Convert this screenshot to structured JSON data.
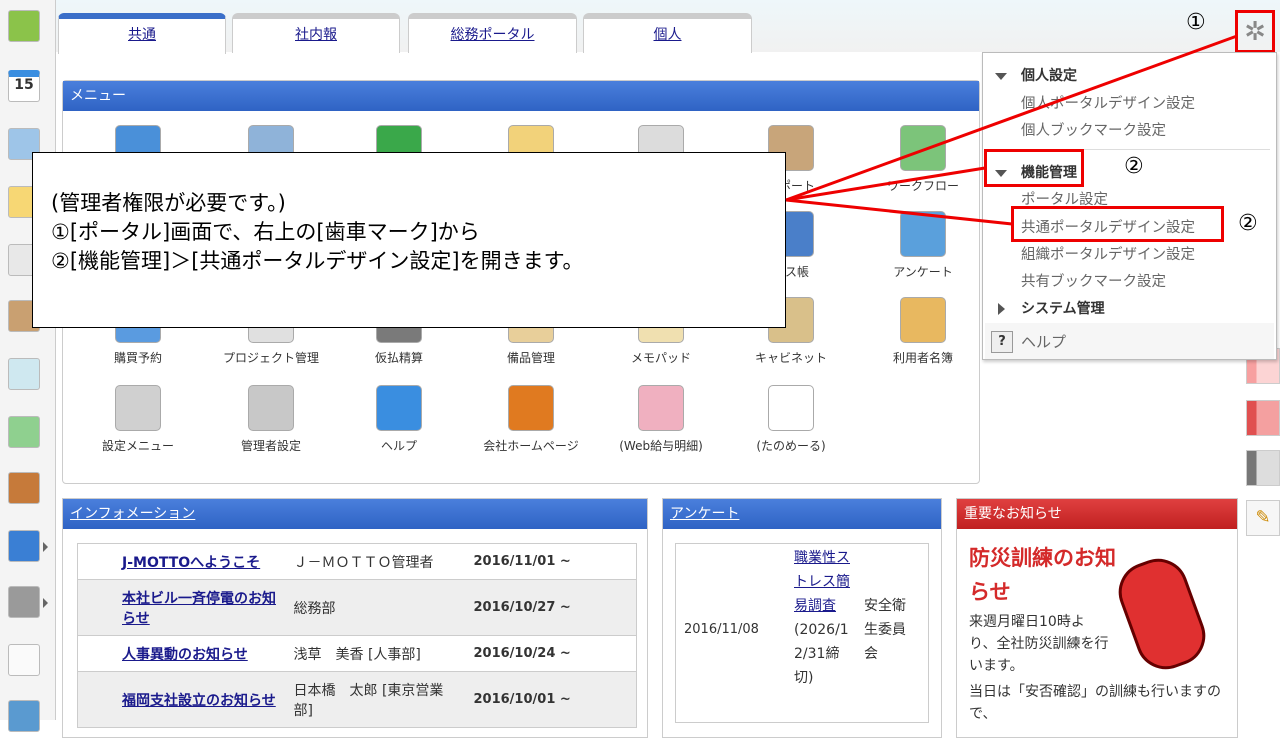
{
  "tabs": [
    {
      "label": "共通",
      "active": true
    },
    {
      "label": "社内報"
    },
    {
      "label": "総務ポータル"
    },
    {
      "label": "個人"
    }
  ],
  "sidebar": {
    "icons": [
      "portal-icon",
      "calendar-icon",
      "chart-icon",
      "memo-icon",
      "board-icon",
      "clipboard-icon",
      "survey-icon",
      "workflow-icon",
      "cabinet-icon",
      "neo-icon",
      "folder-icon",
      "tanomeru-icon",
      "banner-icon"
    ],
    "calendar_day": "15"
  },
  "menu": {
    "title": "メニュー",
    "row1": [
      {
        "label": "",
        "color": "#4a90d9"
      },
      {
        "label": "",
        "color": "#8fb3d9"
      },
      {
        "label": "",
        "color": "#3aa84a"
      },
      {
        "label": "",
        "color": "#f2d27a"
      },
      {
        "label": "",
        "color": "#dcdcdc"
      },
      {
        "label": "レポート",
        "color": "#c8a57a"
      },
      {
        "label": "ワークフロー",
        "color": "#7cc47a"
      }
    ],
    "row2": [
      {
        "label": "レス帳",
        "color": "#4a7fc9"
      },
      {
        "label": "アンケート",
        "color": "#5aa0dc"
      }
    ],
    "row3": [
      {
        "label": "購買予約",
        "color": "#5a9be0"
      },
      {
        "label": "プロジェクト管理",
        "color": "#e0e0e0"
      },
      {
        "label": "仮払精算",
        "color": "#7a7a7a"
      },
      {
        "label": "備品管理",
        "color": "#e8cf9a"
      },
      {
        "label": "メモパッド",
        "color": "#f0e0b0"
      },
      {
        "label": "キャビネット",
        "color": "#d9c08a"
      },
      {
        "label": "利用者名簿",
        "color": "#e8b860"
      }
    ],
    "row4": [
      {
        "label": "設定メニュー",
        "color": "#d0d0d0"
      },
      {
        "label": "管理者設定",
        "color": "#c8c8c8"
      },
      {
        "label": "ヘルプ",
        "color": "#3a8ee0"
      },
      {
        "label": "会社ホームページ",
        "color": "#e07a20"
      },
      {
        "label": "(Web給与明細)",
        "color": "#f0b0c0"
      },
      {
        "label": "(たのめーる)",
        "color": "#ffffff"
      }
    ]
  },
  "callout": {
    "line1": "(管理者権限が必要です。)",
    "line2": "①[ポータル]画面で、右上の[歯車マーク]から",
    "line3": "②[機能管理]＞[共通ポータルデザイン設定]を開きます。"
  },
  "markers": {
    "one": "①",
    "two": "②"
  },
  "dropdown": {
    "personal": {
      "title": "個人設定",
      "items": [
        "個人ポータルデザイン設定",
        "個人ブックマーク設定"
      ]
    },
    "function": {
      "title": "機能管理",
      "items": [
        "ポータル設定",
        "共通ポータルデザイン設定",
        "組織ポータルデザイン設定",
        "共有ブックマーク設定"
      ]
    },
    "system": {
      "title": "システム管理"
    },
    "help": {
      "icon": "?",
      "label": "ヘルプ"
    }
  },
  "info": {
    "title": "インフォメーション",
    "rows": [
      {
        "title": "J-MOTTOへようこそ",
        "author": "Ｊ－ＭＯＴＴＯ管理者",
        "date": "2016/11/01 ~"
      },
      {
        "title": "本社ビル一斉停電のお知らせ",
        "author": "総務部",
        "date": "2016/10/27 ~"
      },
      {
        "title": "人事異動のお知らせ",
        "author": "浅草　美香 [人事部]",
        "date": "2016/10/24 ~"
      },
      {
        "title": "福岡支社設立のお知らせ",
        "author": "日本橋　太郎 [東京営業部]",
        "date": "2016/10/01 ~"
      }
    ]
  },
  "anket": {
    "title": "アンケート",
    "date": "2016/11/08",
    "link": "職業性ストレス簡易調査",
    "suffix": "(2026/12/31締切)",
    "owner": "安全衛生委員会"
  },
  "notice": {
    "title": "重要なお知らせ",
    "heading": "防災訓練のお知らせ",
    "body": "来週月曜日10時より、全社防災訓練を行います。",
    "body2": "当日は「安否確認」の訓練も行いますので、"
  },
  "colors": {
    "accent": "#3b6fc9",
    "highlight": "#ee0000",
    "notice": "#d42a2a"
  }
}
